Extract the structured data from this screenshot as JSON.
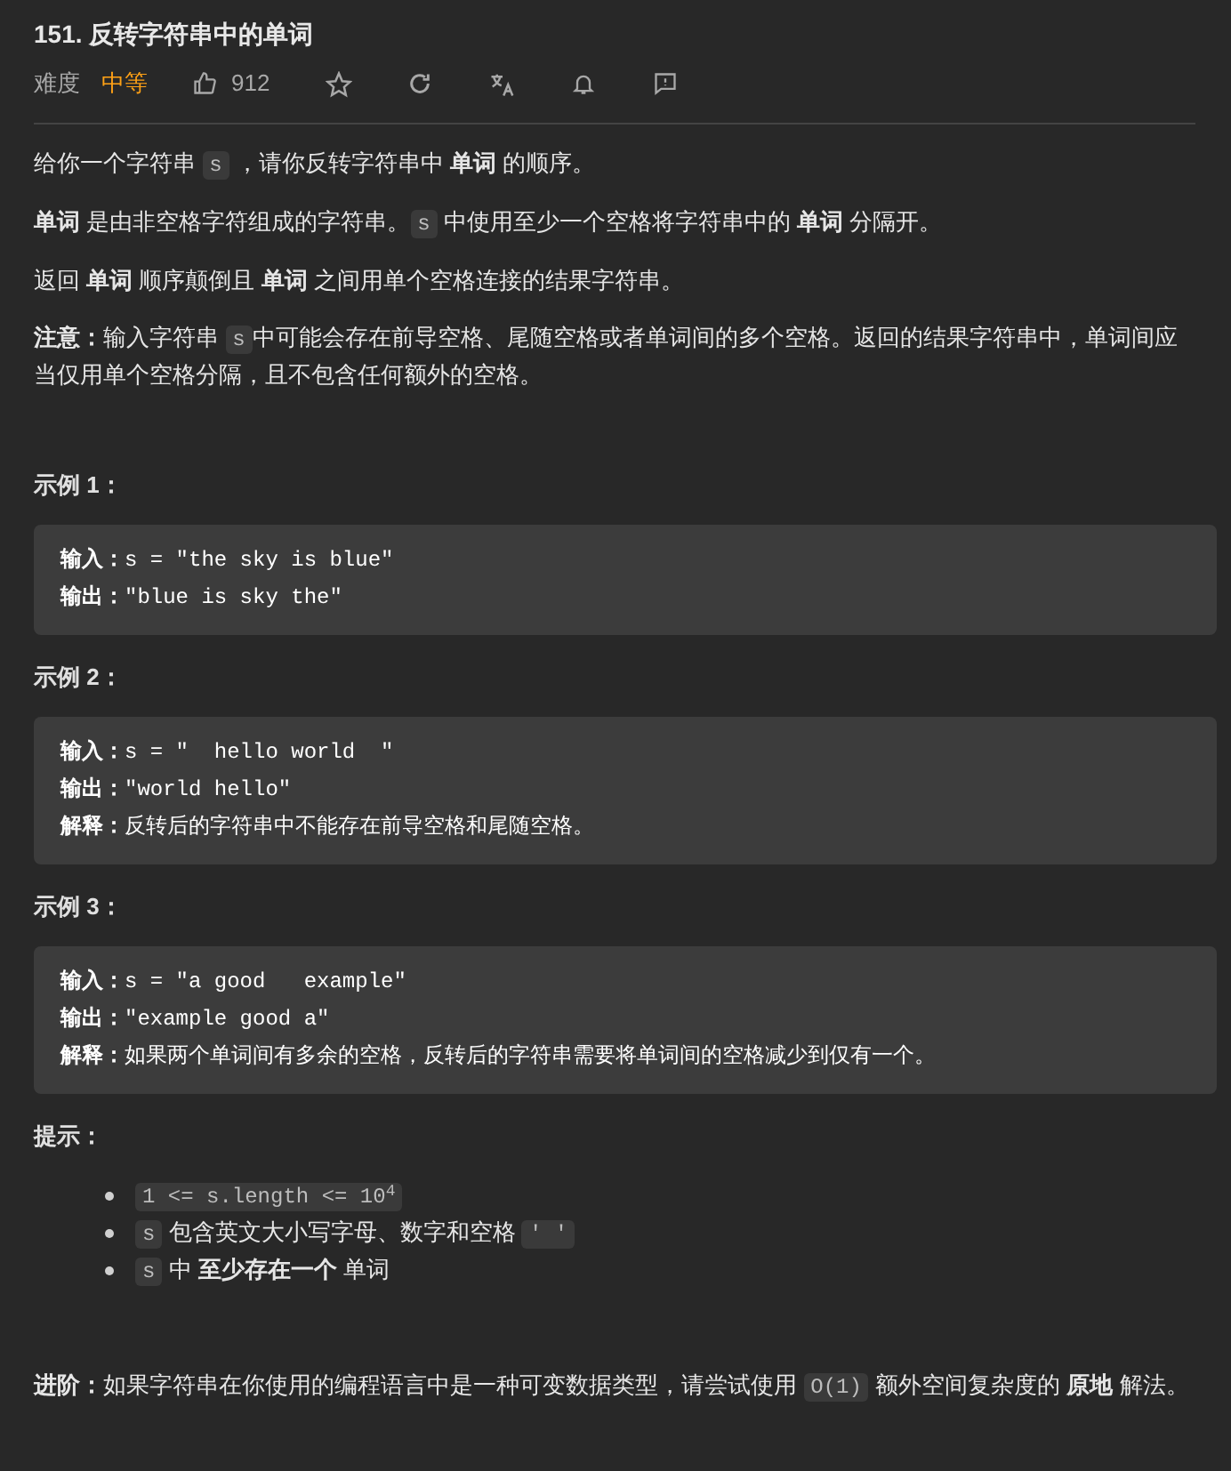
{
  "title": "151. 反转字符串中的单词",
  "toolbar": {
    "difficulty_label": "难度",
    "difficulty": "中等",
    "likes": "912"
  },
  "sections": [
    {
      "kind": "paragraph",
      "segments": [
        {
          "kind": "text",
          "text": "给你一个字符串 "
        },
        {
          "kind": "code",
          "text": "s"
        },
        {
          "kind": "text",
          "text": " ，请你反转字符串中 **单词** 的顺序。"
        }
      ]
    },
    {
      "kind": "paragraph",
      "segments": [
        {
          "kind": "text",
          "text": "**单词** 是由非空格字符组成的字符串。"
        },
        {
          "kind": "code",
          "text": "s"
        },
        {
          "kind": "text",
          "text": " 中使用至少一个空格将字符串中的 **单词** 分隔开。"
        }
      ]
    },
    {
      "kind": "paragraph",
      "segments": [
        {
          "kind": "text",
          "text": "返回 **单词** 顺序颠倒且 **单词** 之间用单个空格连接的结果字符串。"
        }
      ]
    },
    {
      "kind": "paragraph",
      "segments": [
        {
          "kind": "text",
          "text": "**注意：**输入字符串 "
        },
        {
          "kind": "code",
          "text": "s"
        },
        {
          "kind": "text",
          "text": "中可能会存在前导空格、尾随空格或者单词间的多个空格。返回的结果字符串中，单词间应当仅用单个空格分隔，且不包含任何额外的空格。"
        }
      ]
    },
    {
      "kind": "heading",
      "text": "示例 1："
    },
    {
      "kind": "example",
      "lines": [
        {
          "label": "输入：",
          "value": "s = \"the sky is blue\""
        },
        {
          "label": "输出：",
          "value": "\"blue is sky the\""
        }
      ]
    },
    {
      "kind": "heading",
      "text": "示例 2："
    },
    {
      "kind": "example",
      "lines": [
        {
          "label": "输入：",
          "value": "s = \"  hello world  \""
        },
        {
          "label": "输出：",
          "value": "\"world hello\""
        },
        {
          "label": "解释：",
          "value": "反转后的字符串中不能存在前导空格和尾随空格。"
        }
      ]
    },
    {
      "kind": "heading",
      "text": "示例 3："
    },
    {
      "kind": "example",
      "lines": [
        {
          "label": "输入：",
          "value": "s = \"a good   example\""
        },
        {
          "label": "输出：",
          "value": "\"example good a\""
        },
        {
          "label": "解释：",
          "value": "如果两个单词间有多余的空格，反转后的字符串需要将单词间的空格减少到仅有一个。"
        }
      ]
    },
    {
      "kind": "heading",
      "text": "提示："
    },
    {
      "kind": "list",
      "items": [
        [
          {
            "kind": "code",
            "text": "1 <= s.length <= 10$^{4}$"
          }
        ],
        [
          {
            "kind": "code",
            "text": "s"
          },
          {
            "kind": "text",
            "text": " 包含英文大小写字母、数字和空格 "
          },
          {
            "kind": "code",
            "text": "' '"
          }
        ],
        [
          {
            "kind": "code",
            "text": "s"
          },
          {
            "kind": "text",
            "text": " 中 **至少存在一个** 单词"
          }
        ]
      ]
    },
    {
      "kind": "paragraph",
      "segments": [
        {
          "kind": "text",
          "text": "**进阶：**如果字符串在你使用的编程语言中是一种可变数据类型，请尝试使用 "
        },
        {
          "kind": "code",
          "text": "O(1)"
        },
        {
          "kind": "text",
          "text": " 额外空间复杂度的 **原地** 解法。"
        }
      ]
    }
  ]
}
